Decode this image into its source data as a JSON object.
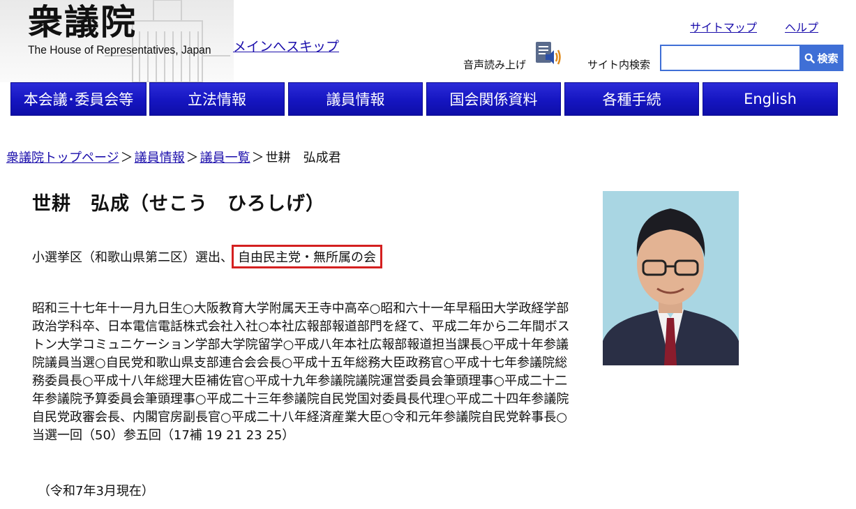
{
  "header": {
    "logo_kanji": "衆議院",
    "logo_english": "The House of Representatives, Japan",
    "skip_link": "メインへスキップ",
    "sitemap": "サイトマップ",
    "help": "ヘルプ",
    "voice_read": "音声読み上げ",
    "site_search_label": "サイト内検索",
    "search_value": "",
    "search_button": "検索"
  },
  "nav": {
    "items": [
      {
        "label": "本会議･委員会等"
      },
      {
        "label": "立法情報"
      },
      {
        "label": "議員情報"
      },
      {
        "label": "国会関係資料"
      },
      {
        "label": "各種手続"
      },
      {
        "label": "English"
      }
    ]
  },
  "breadcrumb": {
    "home": "衆議院トップページ",
    "members_info": "議員情報",
    "members_list": "議員一覧",
    "current": "世耕　弘成君",
    "separator": "＞"
  },
  "profile": {
    "name": "世耕　弘成（せこう　ひろしげ）",
    "district": "小選挙区（和歌山県第二区）選出、",
    "party": "自由民主党・無所属の会",
    "bio": "昭和三十七年十一月九日生○大阪教育大学附属天王寺中高卒○昭和六十一年早稲田大学政経学部政治学科卒、日本電信電話株式会社入社○本社広報部報道部門を経て、平成二年から二年間ボストン大学コミュニケーション学部大学院留学○平成八年本社広報部報道担当課長○平成十年参議院議員当選○自民党和歌山県支部連合会会長○平成十五年総務大臣政務官○平成十七年参議院総務委員長○平成十八年総理大臣補佐官○平成十九年参議院議院運営委員会筆頭理事○平成二十二年参議院予算委員会筆頭理事○平成二十三年参議院自民党国対委員長代理○平成二十四年参議院自民党政審会長、内閣官房副長官○平成二十八年経済産業大臣○令和元年参議院自民党幹事長○当選一回（50）参五回（17補 19 21 23 25）",
    "as_of": "（令和7年3月現在）"
  }
}
